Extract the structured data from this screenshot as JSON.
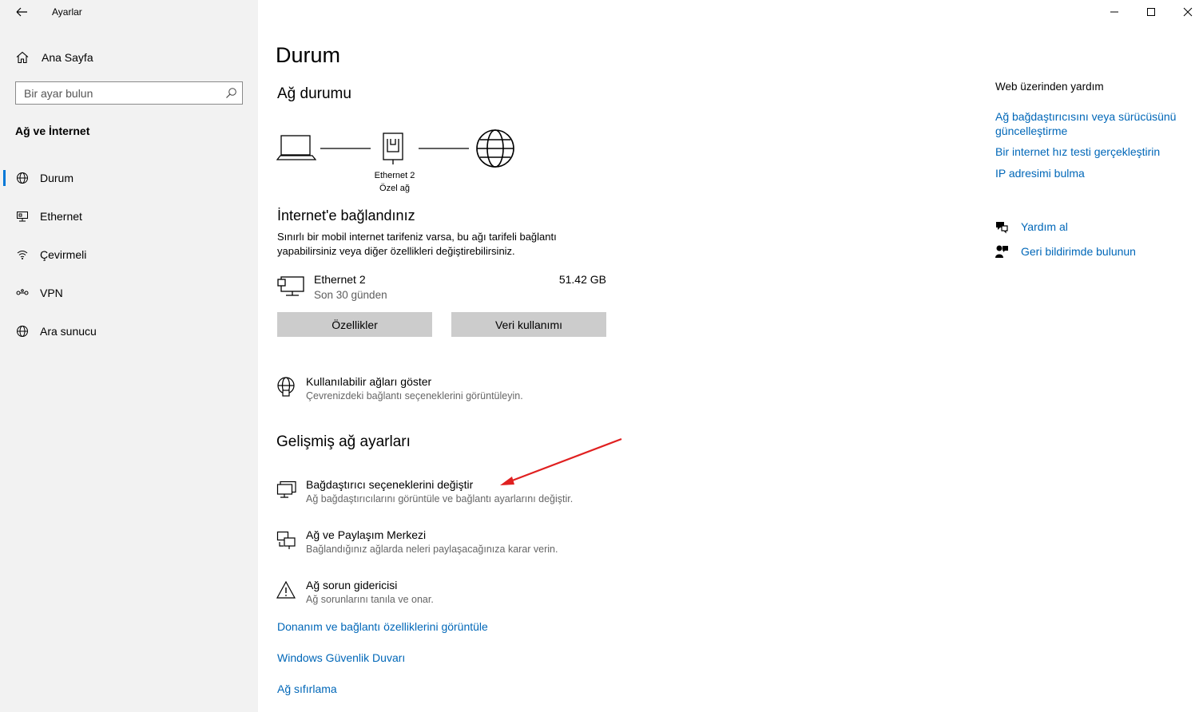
{
  "window": {
    "app_title": "Ayarlar",
    "controls": [
      "minimize-button",
      "maximize-button",
      "close-button"
    ]
  },
  "sidebar": {
    "home_label": "Ana Sayfa",
    "search_placeholder": "Bir ayar bulun",
    "category_title": "Ağ ve İnternet",
    "items": [
      {
        "label": "Durum",
        "icon": "status-globe-icon",
        "active": true
      },
      {
        "label": "Ethernet",
        "icon": "ethernet-icon",
        "active": false
      },
      {
        "label": "Çevirmeli",
        "icon": "dialup-icon",
        "active": false
      },
      {
        "label": "VPN",
        "icon": "vpn-icon",
        "active": false
      },
      {
        "label": "Ara sunucu",
        "icon": "proxy-globe-icon",
        "active": false
      }
    ]
  },
  "main": {
    "page_title": "Durum",
    "network_status_heading": "Ağ durumu",
    "diagram": {
      "adapter_name": "Ethernet 2",
      "network_type": "Özel ağ"
    },
    "connected_heading": "İnternet'e bağlandınız",
    "connected_desc": "Sınırlı bir mobil internet tarifeniz varsa, bu ağı tarifeli bağlantı yapabilirsiniz veya diğer özellikleri değiştirebilirsiniz.",
    "usage": {
      "name": "Ethernet 2",
      "period": "Son 30 günden",
      "amount": "51.42 GB"
    },
    "buttons": {
      "properties": "Özellikler",
      "data_usage": "Veri kullanımı"
    },
    "show_networks": {
      "title": "Kullanılabilir ağları göster",
      "desc": "Çevrenizdeki bağlantı seçeneklerini görüntüleyin."
    },
    "advanced_heading": "Gelişmiş ağ ayarları",
    "advanced_options": [
      {
        "title": "Bağdaştırıcı seçeneklerini değiştir",
        "desc": "Ağ bağdaştırıcılarını görüntüle ve bağlantı ayarlarını değiştir.",
        "icon": "adapter-icon"
      },
      {
        "title": "Ağ ve Paylaşım Merkezi",
        "desc": "Bağlandığınız ağlarda neleri paylaşacağınıza karar verin.",
        "icon": "sharing-center-icon"
      },
      {
        "title": "Ağ sorun gidericisi",
        "desc": "Ağ sorunlarını tanıla ve onar.",
        "icon": "warning-icon"
      }
    ],
    "links": [
      "Donanım ve bağlantı özelliklerini görüntüle",
      "Windows Güvenlik Duvarı",
      "Ağ sıfırlama"
    ]
  },
  "right_panel": {
    "web_help_title": "Web üzerinden yardım",
    "help_links": [
      "Ağ bağdaştırıcısını veya sürücüsünü güncelleştirme",
      "Bir internet hız testi gerçekleştirin",
      "IP adresimi bulma"
    ],
    "get_help": "Yardım al",
    "feedback": "Geri bildirimde bulunun"
  },
  "colors": {
    "accent": "#0078d7",
    "link": "#0067b8",
    "sidebar_bg": "#f2f2f2",
    "button_bg": "#cccccc",
    "annotation_arrow": "#e02020"
  }
}
